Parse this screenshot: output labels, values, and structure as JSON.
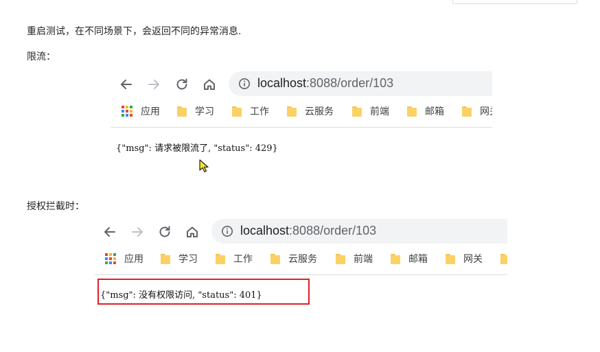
{
  "doc": {
    "intro": "重启测试，在不同场景下，会返回不同的异常消息.",
    "section_rate_limit": "限流：",
    "section_auth": "授权拦截时："
  },
  "browser1": {
    "url_host": "localhost",
    "url_rest": ":8088/order/103",
    "bookmarks": [
      "应用",
      "学习",
      "工作",
      "云服务",
      "前端",
      "邮箱",
      "网关"
    ],
    "response": "{\"msg\": 请求被限流了, \"status\": 429}"
  },
  "browser2": {
    "url_host": "localhost",
    "url_rest": ":8088/order/103",
    "bookmarks": [
      "应用",
      "学习",
      "工作",
      "云服务",
      "前端",
      "邮箱",
      "网关"
    ],
    "response": "{\"msg\": 没有权限访问, \"status\": 401}"
  },
  "colors": {
    "highlight": "#e21d28",
    "folder": "#fad165",
    "address_bar": "#f1f3f4"
  },
  "icons": [
    "back-arrow-icon",
    "forward-arrow-icon",
    "reload-icon",
    "home-icon",
    "info-icon",
    "apps-grid-icon",
    "folder-icon",
    "mouse-cursor-icon"
  ]
}
